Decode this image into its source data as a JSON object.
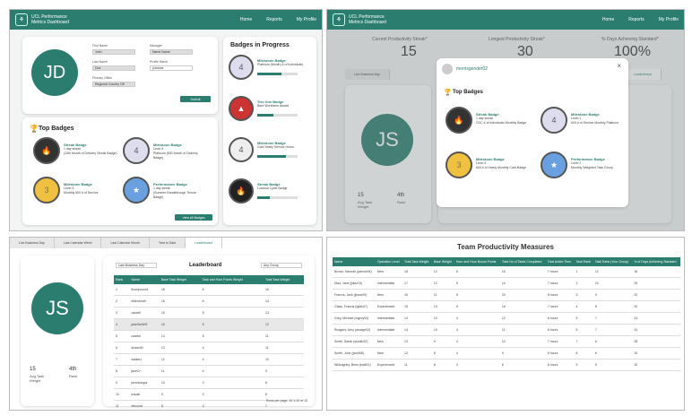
{
  "app": {
    "title_line1": "UCL Performance",
    "title_line2": "Metrics Dashboard",
    "nav": [
      "Home",
      "Reports",
      "My Profile"
    ]
  },
  "panel1": {
    "avatar_initials": "JD",
    "fields": [
      {
        "label": "First Name",
        "value": "John"
      },
      {
        "label": "Last Name",
        "value": "Doe"
      },
      {
        "label": "Primary Office",
        "value": "Regional Country Off"
      },
      {
        "label": "Manager",
        "value": "Name Name"
      },
      {
        "label": "Profile Name",
        "value": "johndoe"
      }
    ],
    "save_label": "Submit",
    "top_badges_title": "Top Badges",
    "top_badges": [
      {
        "name": "Streak Badge",
        "level": "1 day streak",
        "desc": "(10th Month of Delivery Streak Badge)"
      },
      {
        "name": "Milestone Badge",
        "level": "Level 4",
        "desc": "Platinum (600 Month of Delivery Badge)"
      },
      {
        "name": "Milestone Badge",
        "level": "Level 3",
        "desc": "Monthly 500 # of Service"
      },
      {
        "name": "Performance Badge",
        "level": "1 day streak",
        "desc": "(Summer Breakthrough Tenure Badge)"
      }
    ],
    "view_all_label": "View All Badges",
    "in_progress_title": "Badges in Progress",
    "in_progress": [
      {
        "name": "Milestone Badge",
        "desc": "Platinum (Month) # of Individuals",
        "progress": 0.6
      },
      {
        "name": "Tier One Badge",
        "desc": "Bare Workforce Award",
        "progress": 0.4
      },
      {
        "name": "Milestone Badge",
        "desc": "Gold Yearly Service Hours",
        "progress": 0.7
      },
      {
        "name": "Streak Badge",
        "desc": "Loadout Cycle Badge",
        "progress": 0.3
      }
    ]
  },
  "panel2": {
    "stats": [
      {
        "label": "Current Productivity Streak*",
        "value": "15"
      },
      {
        "label": "Longest Productivity Streak*",
        "value": "30"
      },
      {
        "label": "% Days Achieving Standard*",
        "value": "100%"
      }
    ],
    "tabs": [
      "Live Business Day",
      "Leaderboard"
    ],
    "avatar_initials": "JS",
    "modal_user": "morrisgender02",
    "modal_close": "×",
    "modal_top_badges": "Top Badges",
    "modal_badges": [
      {
        "name": "Streak Badge",
        "level": "1 day streak",
        "desc": "CDC # of Individuals Monthly Badge"
      },
      {
        "name": "Milestone Badge",
        "level": "Level 1",
        "desc": "600 # of Service Monthly Platinum"
      },
      {
        "name": "Milestone Badge",
        "level": "Level 4",
        "desc": "600 # of Yearly Monthly Card Badge"
      },
      {
        "name": "Performance Badge",
        "level": "Level 2",
        "desc": "Monthly Weighted Task Group"
      }
    ],
    "stat_small": [
      {
        "v": "15",
        "l": "Avg Task Weight"
      },
      {
        "v": "4th",
        "l": "Rank"
      }
    ]
  },
  "panel3": {
    "tabs": [
      "Live Business Day",
      "Last Calendar Week",
      "Last Calendar Month",
      "Year to Date",
      "Leaderboard"
    ],
    "avatar_initials": "JS",
    "select_left": "Last Business Day",
    "select_right": "Any Group",
    "leaderboard_title": "Leaderboard",
    "columns": [
      "Rank",
      "Name",
      "Base Task Weight",
      "Task and Hour Points Weight",
      "Total Task Weight"
    ],
    "rows": [
      [
        "1",
        "thompsonn1",
        "18",
        "6",
        "16"
      ],
      [
        "2",
        "eliteneruth",
        "16",
        "6",
        "14"
      ],
      [
        "3",
        "cardell",
        "15",
        "5",
        "13"
      ],
      [
        "4",
        "jadeSmithR",
        "15",
        "5",
        "12"
      ],
      [
        "5",
        "ncartel",
        "14",
        "5",
        "11"
      ],
      [
        "6",
        "shawnM",
        "13",
        "4",
        "11"
      ],
      [
        "7",
        "walkerJ",
        "12",
        "4",
        "10"
      ],
      [
        "8",
        "jaceCr",
        "11",
        "4",
        "9"
      ],
      [
        "9",
        "jennisongot",
        "10",
        "3",
        "8"
      ],
      [
        "10",
        "trauall",
        "9",
        "3",
        "8"
      ],
      [
        "11",
        "elenzurt",
        "8",
        "3",
        "7"
      ]
    ],
    "stat_small": [
      {
        "v": "15",
        "l": "Avg Task Weight"
      },
      {
        "v": "4th",
        "l": "Rank"
      }
    ],
    "pagination": "Rows per page: 10   1-10 of 15"
  },
  "panel4": {
    "title": "Team Productivity Measures",
    "columns": [
      "Name",
      "Operation Level",
      "Total Task Weight",
      "Base Weight",
      "Hour and Hour Bonus Points",
      "Total No of Tasks Completed",
      "Total Active Time",
      "Task Rank",
      "Task Rank (Your Group)",
      "% of Days Achieving Standard"
    ],
    "rows": [
      [
        "Brown, Hannah (jabrow04)",
        "New",
        "18",
        "12",
        "6",
        "15",
        "7 hours",
        "1",
        "12",
        "16"
      ],
      [
        "Diaz, Jane (jdiaz15)",
        "Intermediate",
        "17",
        "12",
        "5",
        "14",
        "7 hours",
        "2",
        "10",
        "25"
      ],
      [
        "Francis, Jack (jfranc09)",
        "New",
        "16",
        "11",
        "5",
        "20",
        "8 hours",
        "3",
        "9",
        "20"
      ],
      [
        "Glass, Francis (fglas07)",
        "Experienced",
        "15",
        "10",
        "5",
        "16",
        "7 hours",
        "4",
        "8",
        "20"
      ],
      [
        "Grey, Michael (mgrey03)",
        "Intermediate",
        "14",
        "10",
        "4",
        "12",
        "6 hours",
        "5",
        "7",
        "24"
      ],
      [
        "Rodgers, Amy (arodge02)",
        "Intermediate",
        "14",
        "10",
        "4",
        "11",
        "6 hours",
        "6",
        "7",
        "31"
      ],
      [
        "Smith, Sarah (ssmith22)",
        "New",
        "13",
        "9",
        "4",
        "10",
        "7 hours",
        "7",
        "6",
        "28"
      ],
      [
        "Smith, John (jsmit08)",
        "New",
        "12",
        "8",
        "4",
        "9",
        "5 hours",
        "8",
        "6",
        "20"
      ],
      [
        "Willoughby, Benn (bwill11)",
        "Experienced",
        "11",
        "8",
        "3",
        "8",
        "6 hours",
        "9",
        "5",
        "20"
      ]
    ]
  },
  "colors": {
    "accent": "#2a7d6f",
    "flame": "#e07a20"
  }
}
